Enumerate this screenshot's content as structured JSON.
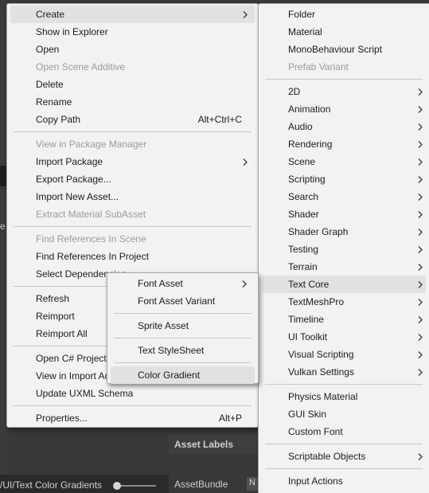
{
  "background": {
    "left_glyph": "e",
    "path_text": "/UI/Text Color Gradients",
    "asset_labels": "Asset Labels",
    "asset_bundle": "AssetBundle",
    "asset_bundle_value": "N"
  },
  "main_menu": {
    "create": "Create",
    "show_in_explorer": "Show in Explorer",
    "open": "Open",
    "open_scene_additive": "Open Scene Additive",
    "delete": "Delete",
    "rename": "Rename",
    "copy_path": "Copy Path",
    "copy_path_shortcut": "Alt+Ctrl+C",
    "view_in_package_manager": "View in Package Manager",
    "import_package": "Import Package",
    "export_package": "Export Package...",
    "import_new_asset": "Import New Asset...",
    "extract_material_subasset": "Extract Material SubAsset",
    "find_references_in_scene": "Find References In Scene",
    "find_references_in_project": "Find References In Project",
    "select_dependencies": "Select Dependencies",
    "refresh": "Refresh",
    "reimport": "Reimport",
    "reimport_all": "Reimport All",
    "open_csharp_project": "Open C# Project",
    "view_in_import_activity": "View in Import Activity",
    "update_uxml_schema": "Update UXML Schema",
    "properties": "Properties...",
    "properties_shortcut": "Alt+P"
  },
  "create_menu": {
    "folder": "Folder",
    "material": "Material",
    "monobehaviour_script": "MonoBehaviour Script",
    "prefab_variant": "Prefab Variant",
    "2d": "2D",
    "animation": "Animation",
    "audio": "Audio",
    "rendering": "Rendering",
    "scene": "Scene",
    "scripting": "Scripting",
    "search": "Search",
    "shader": "Shader",
    "shader_graph": "Shader Graph",
    "testing": "Testing",
    "terrain": "Terrain",
    "text_core": "Text Core",
    "textmeshpro": "TextMeshPro",
    "timeline": "Timeline",
    "ui_toolkit": "UI Toolkit",
    "visual_scripting": "Visual Scripting",
    "vulkan_settings": "Vulkan Settings",
    "physics_material": "Physics Material",
    "gui_skin": "GUI Skin",
    "custom_font": "Custom Font",
    "scriptable_objects": "Scriptable Objects",
    "input_actions": "Input Actions"
  },
  "text_core_menu": {
    "font_asset": "Font Asset",
    "font_asset_variant": "Font Asset Variant",
    "sprite_asset": "Sprite Asset",
    "text_stylesheet": "Text StyleSheet",
    "color_gradient": "Color Gradient"
  },
  "colors": {
    "menu_bg": "#f2f2f2",
    "highlight": "#e1e1e1",
    "disabled_text": "#9b9b9b",
    "editor_bg": "#383838"
  },
  "icons": {
    "submenu": "chevron-right-icon",
    "slider": "slider-knob"
  }
}
